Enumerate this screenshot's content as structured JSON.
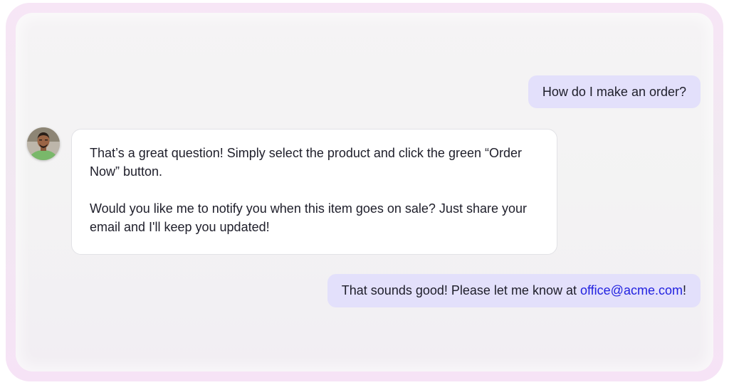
{
  "conversation": {
    "user_message_1": "How do I make an order?",
    "bot_message": {
      "paragraph_1": "That’s a great question! Simply select the product and click the green “Order Now” button.",
      "paragraph_2": "Would you like me to notify you when this item goes on sale? Just share your email and I'll keep you updated!"
    },
    "user_message_2": {
      "text_before": "That sounds good! Please let me know at ",
      "email": "office@acme.com",
      "text_after": "!"
    },
    "bot_avatar_icon": "person-avatar-icon"
  },
  "colors": {
    "user_bubble": "#e3e0fb",
    "bot_bubble": "#ffffff",
    "link": "#2222e0",
    "frame_gradient": "#f7e6f6",
    "panel": "#f3f3f3"
  }
}
